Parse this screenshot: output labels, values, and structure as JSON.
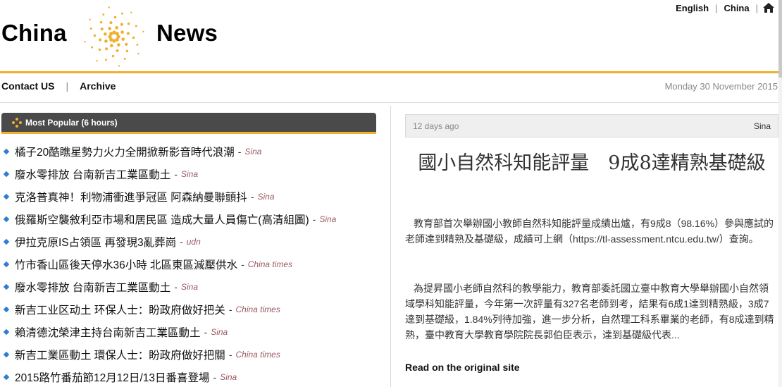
{
  "brand": {
    "left": "China",
    "right": "News"
  },
  "languages": [
    "English",
    "China"
  ],
  "nav": {
    "contact": "Contact US",
    "archive": "Archive"
  },
  "date": "Monday 30 November 2015",
  "popular": {
    "title": "Most Popular (6 hours)",
    "items": [
      {
        "headline": "橘子20酷瞧星勢力火力全開掀新影音時代浪潮",
        "source": "Sina"
      },
      {
        "headline": "廢水零排放 台南新吉工業區動土",
        "source": "Sina"
      },
      {
        "headline": "克洛普真神！利物浦衝進爭冠區 阿森納曼聯顫抖",
        "source": "Sina"
      },
      {
        "headline": "俄羅斯空襲敘利亞市場和居民區 造成大量人員傷亡(高清組圖)",
        "source": "Sina"
      },
      {
        "headline": "伊拉克原IS占領區 再發現3亂葬崗",
        "source": "udn"
      },
      {
        "headline": "竹市香山區後天停水36小時 北區東區減壓供水",
        "source": "China times"
      },
      {
        "headline": "廢水零排放 台南新吉工業區動土",
        "source": "Sina"
      },
      {
        "headline": "新吉工业区动土 环保人士：盼政府做好把关",
        "source": "China times"
      },
      {
        "headline": "賴清德沈榮津主持台南新吉工業區動土",
        "source": "Sina"
      },
      {
        "headline": "新吉工業區動土 環保人士：盼政府做好把關",
        "source": "China times"
      },
      {
        "headline": "2015路竹番茄節12月12日/13日番喜登場",
        "source": "Sina"
      }
    ]
  },
  "article": {
    "age": "12 days ago",
    "source": "Sina",
    "title": "國小自然科知能評量　9成8達精熟基礎級",
    "paragraphs": [
      "教育部首次舉辦國小教師自然科知能評量成績出爐，有9成8（98.16%）參與應試的老師達到精熟及基礎級，成績可上網（https://tl-assessment.ntcu.edu.tw/）查詢。",
      "為提昇國小老師自然科的教學能力，教育部委託國立臺中教育大學舉辦國小自然領域學科知能評量，今年第一次評量有327名老師到考，結果有6成1達到精熟級，3成7達到基礎級，1.84%列待加強，進一步分析，自然理工科系畢業的老師，有8成達到精熟，臺中教育大學教育學院院長郭伯臣表示，達到基礎級代表..."
    ],
    "read_link": "Read on the original site"
  },
  "colors": {
    "accent": "#f0b030",
    "bullet": "#2f7dd3",
    "source": "#9a5a62",
    "panel": "#4a4a4a"
  },
  "icons": {
    "logo": "swirl-dots-logo",
    "home": "home-icon",
    "popular": "diamond-dots-icon"
  }
}
